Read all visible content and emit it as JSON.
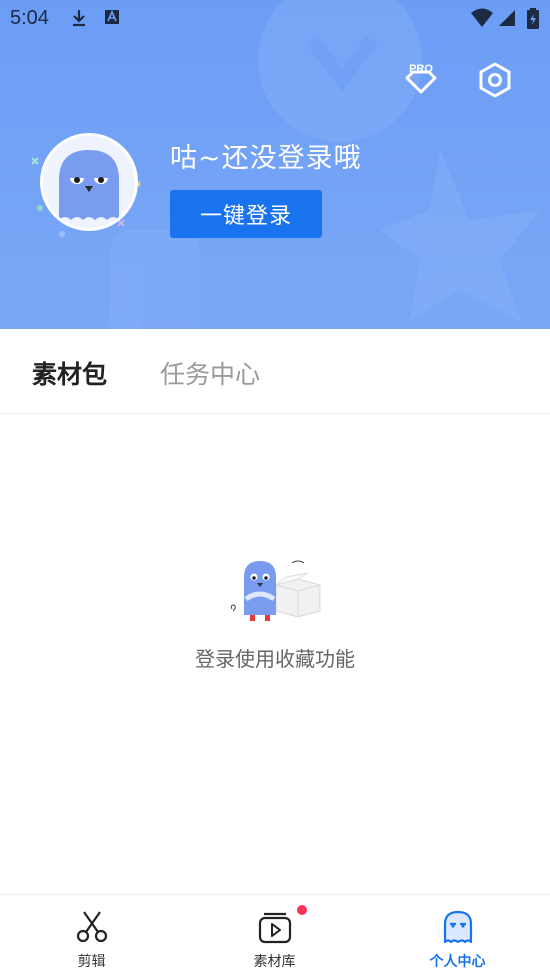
{
  "status_bar": {
    "time": "5:04",
    "icons": [
      "download-icon",
      "font-a-icon",
      "wifi-icon",
      "signal-icon",
      "battery-icon"
    ]
  },
  "header": {
    "pro_label": "PRO",
    "icons": [
      "pro-diamond-icon",
      "settings-hexagon-icon"
    ],
    "greeting": "咕~还没登录哦",
    "login_button": "一键登录"
  },
  "tabs": [
    {
      "label": "素材包",
      "active": true
    },
    {
      "label": "任务中心",
      "active": false
    }
  ],
  "empty_state": {
    "message": "登录使用收藏功能"
  },
  "bottom_nav": [
    {
      "label": "剪辑",
      "icon": "scissors-icon",
      "active": false
    },
    {
      "label": "素材库",
      "icon": "media-library-icon",
      "active": false,
      "badge": true
    },
    {
      "label": "个人中心",
      "icon": "ghost-profile-icon",
      "active": true
    }
  ],
  "colors": {
    "header_bg": "#6c9df5",
    "accent": "#1a73ee",
    "badge": "#ff3355"
  }
}
